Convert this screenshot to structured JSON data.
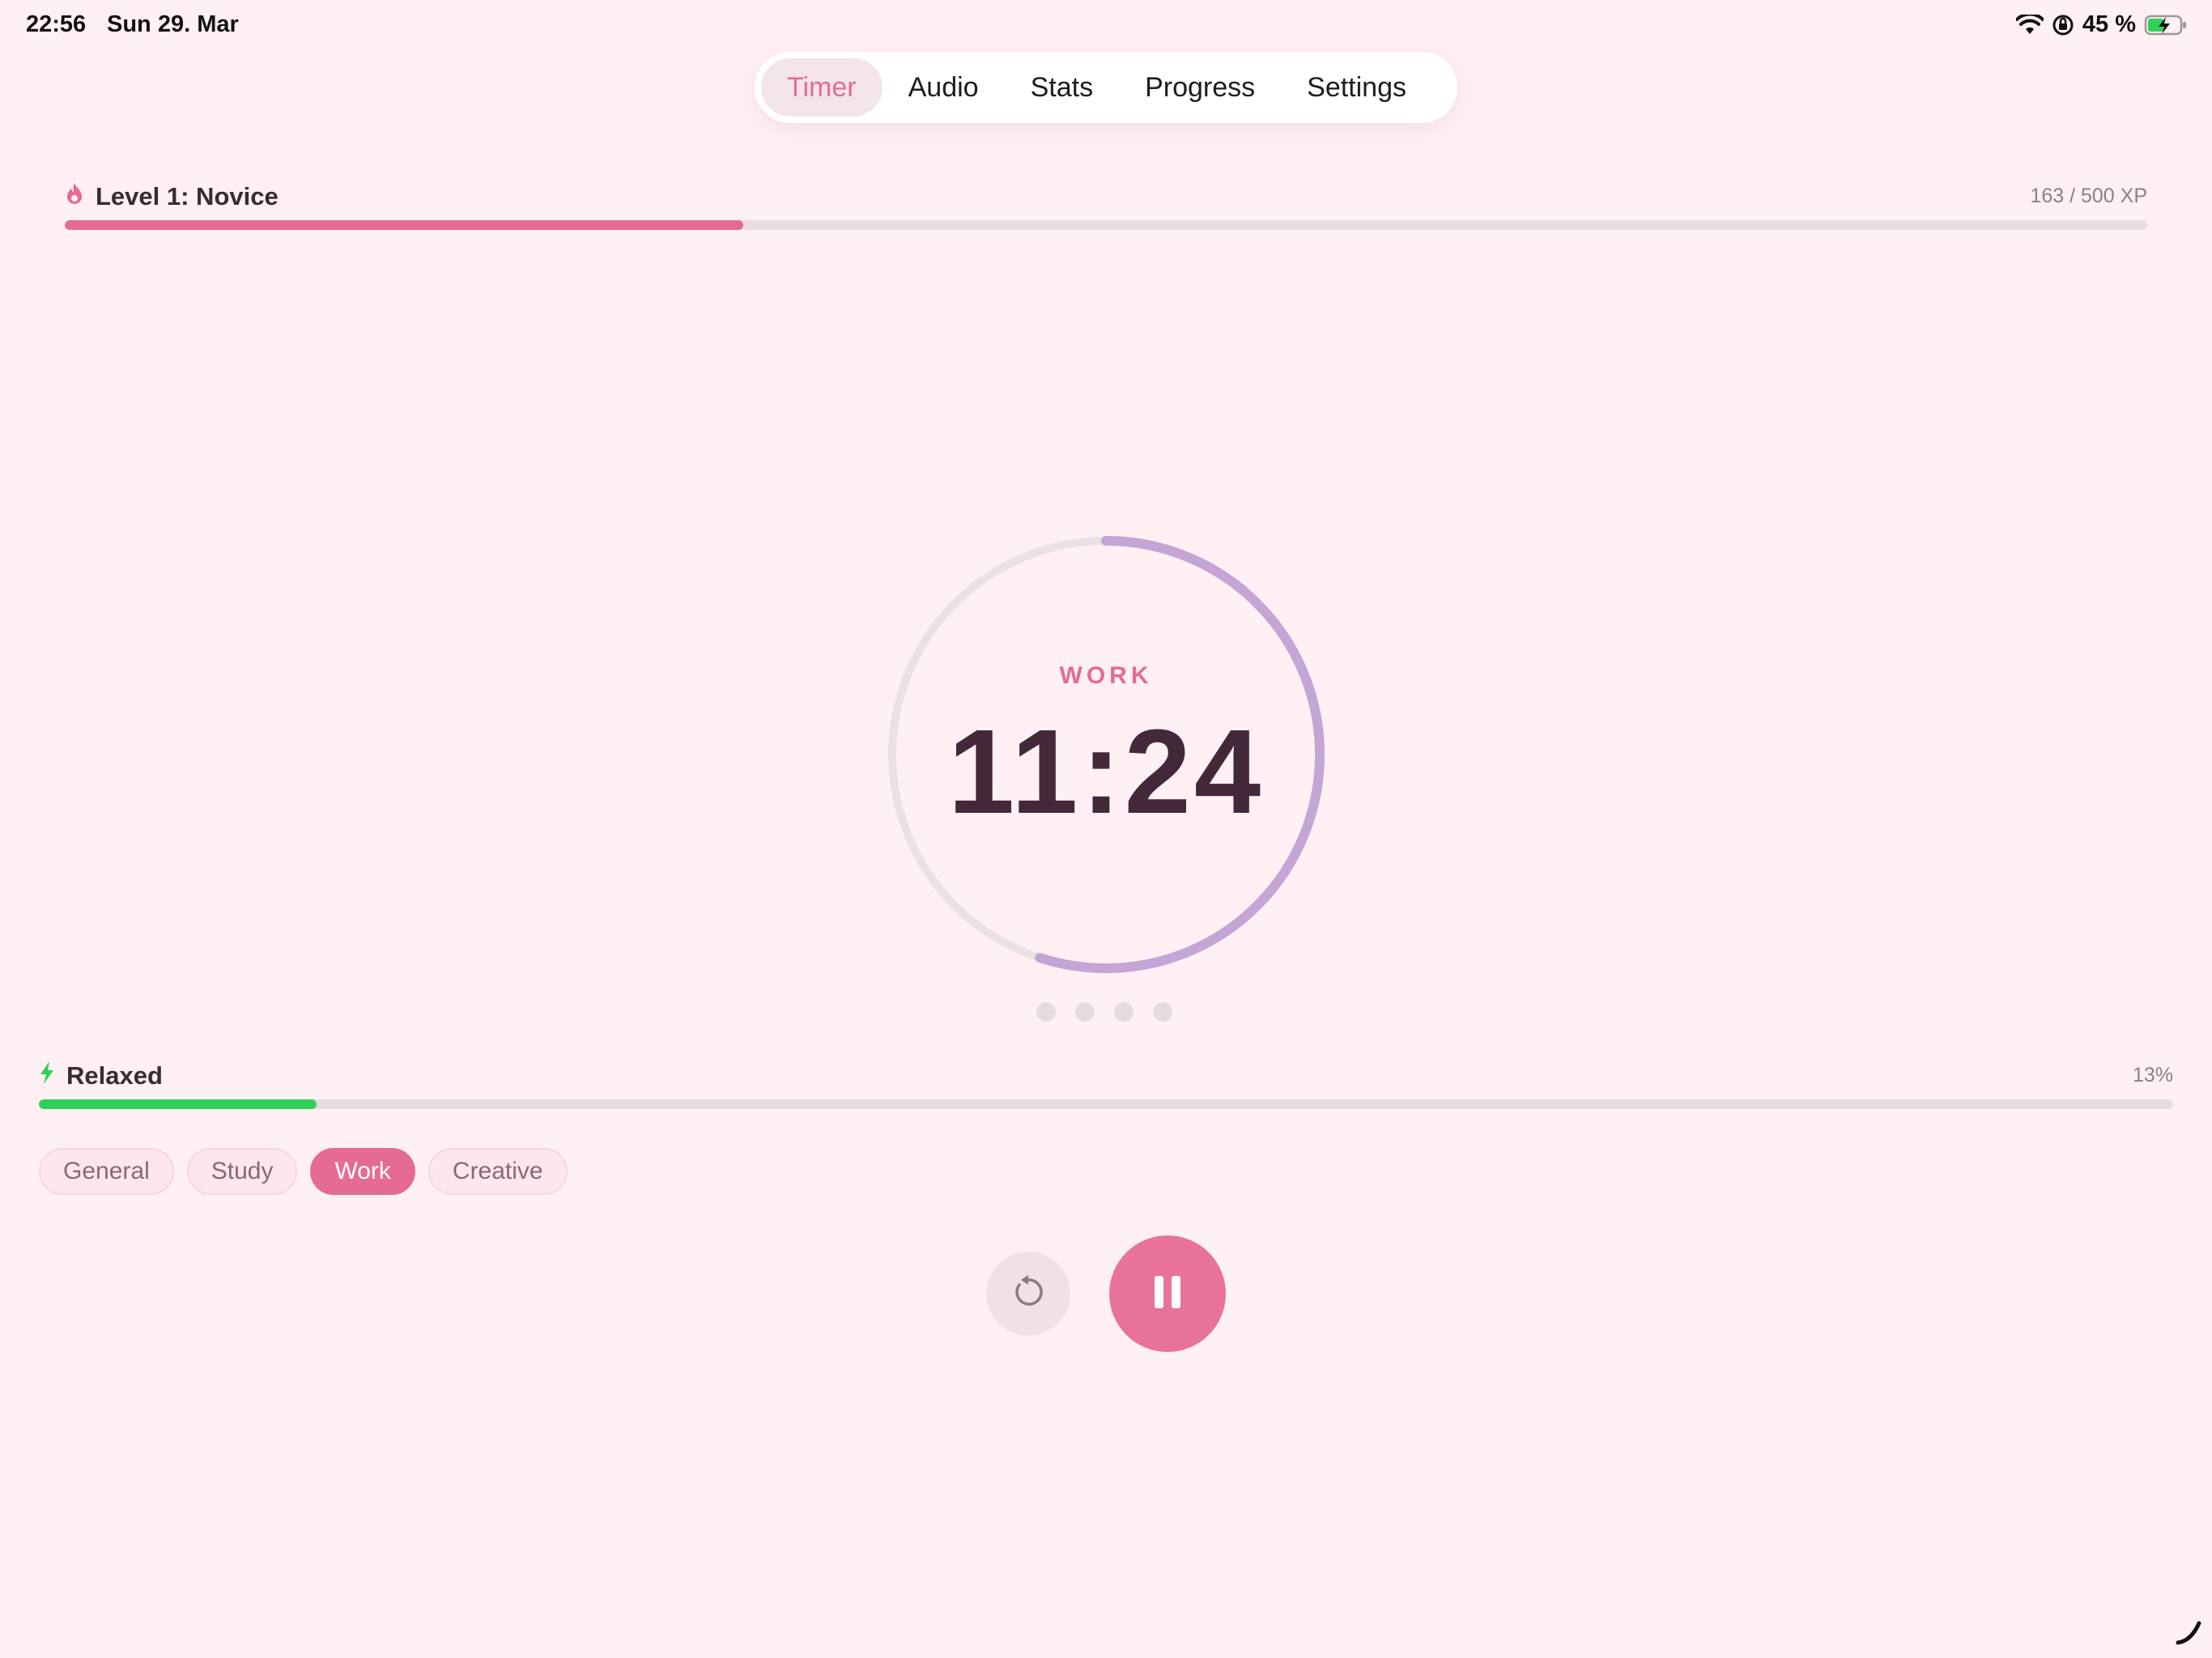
{
  "status_bar": {
    "time": "22:56",
    "date": "Sun 29. Mar",
    "battery_percent": "45 %",
    "icons": [
      "wifi-icon",
      "orientation-lock-icon",
      "battery-charging-icon"
    ]
  },
  "nav": {
    "tabs": [
      {
        "label": "Timer",
        "active": true
      },
      {
        "label": "Audio",
        "active": false
      },
      {
        "label": "Stats",
        "active": false
      },
      {
        "label": "Progress",
        "active": false
      },
      {
        "label": "Settings",
        "active": false
      }
    ]
  },
  "level": {
    "label": "Level 1: Novice",
    "xp_text": "163 / 500 XP",
    "xp_current": 163,
    "xp_max": 500,
    "icon": "flame-icon"
  },
  "timer": {
    "mode": "WORK",
    "time": "11:24",
    "ring_progress": 0.55,
    "session_dots": 4
  },
  "energy": {
    "label": "Relaxed",
    "percent_text": "13%",
    "percent": 13,
    "icon": "bolt-icon"
  },
  "categories": [
    {
      "label": "General",
      "active": false
    },
    {
      "label": "Study",
      "active": false
    },
    {
      "label": "Work",
      "active": true
    },
    {
      "label": "Creative",
      "active": false
    }
  ],
  "controls": {
    "reset_icon": "reset-icon",
    "pause_icon": "pause-icon"
  },
  "colors": {
    "background": "#fff0f3",
    "accent": "#e56b94",
    "ring": "#c3a5d6",
    "energy": "#2fd158"
  }
}
